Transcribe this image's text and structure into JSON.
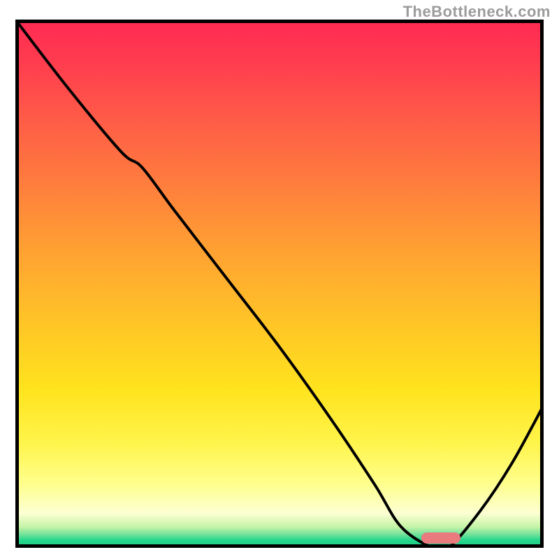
{
  "watermark": "TheBottleneck.com",
  "colors": {
    "border": "#000000",
    "curve": "#000000",
    "baton": "#e97a7e",
    "watermark": "#9c9c9c",
    "gradient_top": "#ff2a52",
    "gradient_bottom": "#17c97f"
  },
  "chart_data": {
    "type": "line",
    "title": "",
    "xlabel": "",
    "ylabel": "",
    "xlim": [
      0,
      100
    ],
    "ylim": [
      0,
      100
    ],
    "grid": false,
    "series": [
      {
        "name": "bottleneck-curve",
        "x": [
          0,
          10,
          20,
          24,
          30,
          40,
          50,
          60,
          68,
          73,
          79,
          82,
          88,
          94,
          100
        ],
        "values": [
          100,
          87,
          75,
          72,
          64,
          51,
          38,
          24,
          12,
          4,
          0,
          0,
          7,
          16,
          27
        ]
      }
    ],
    "annotations": [
      {
        "name": "optimum-marker",
        "x_center": 80.5,
        "y": 0,
        "width": 7.4,
        "color": "#e97a7e"
      }
    ]
  }
}
